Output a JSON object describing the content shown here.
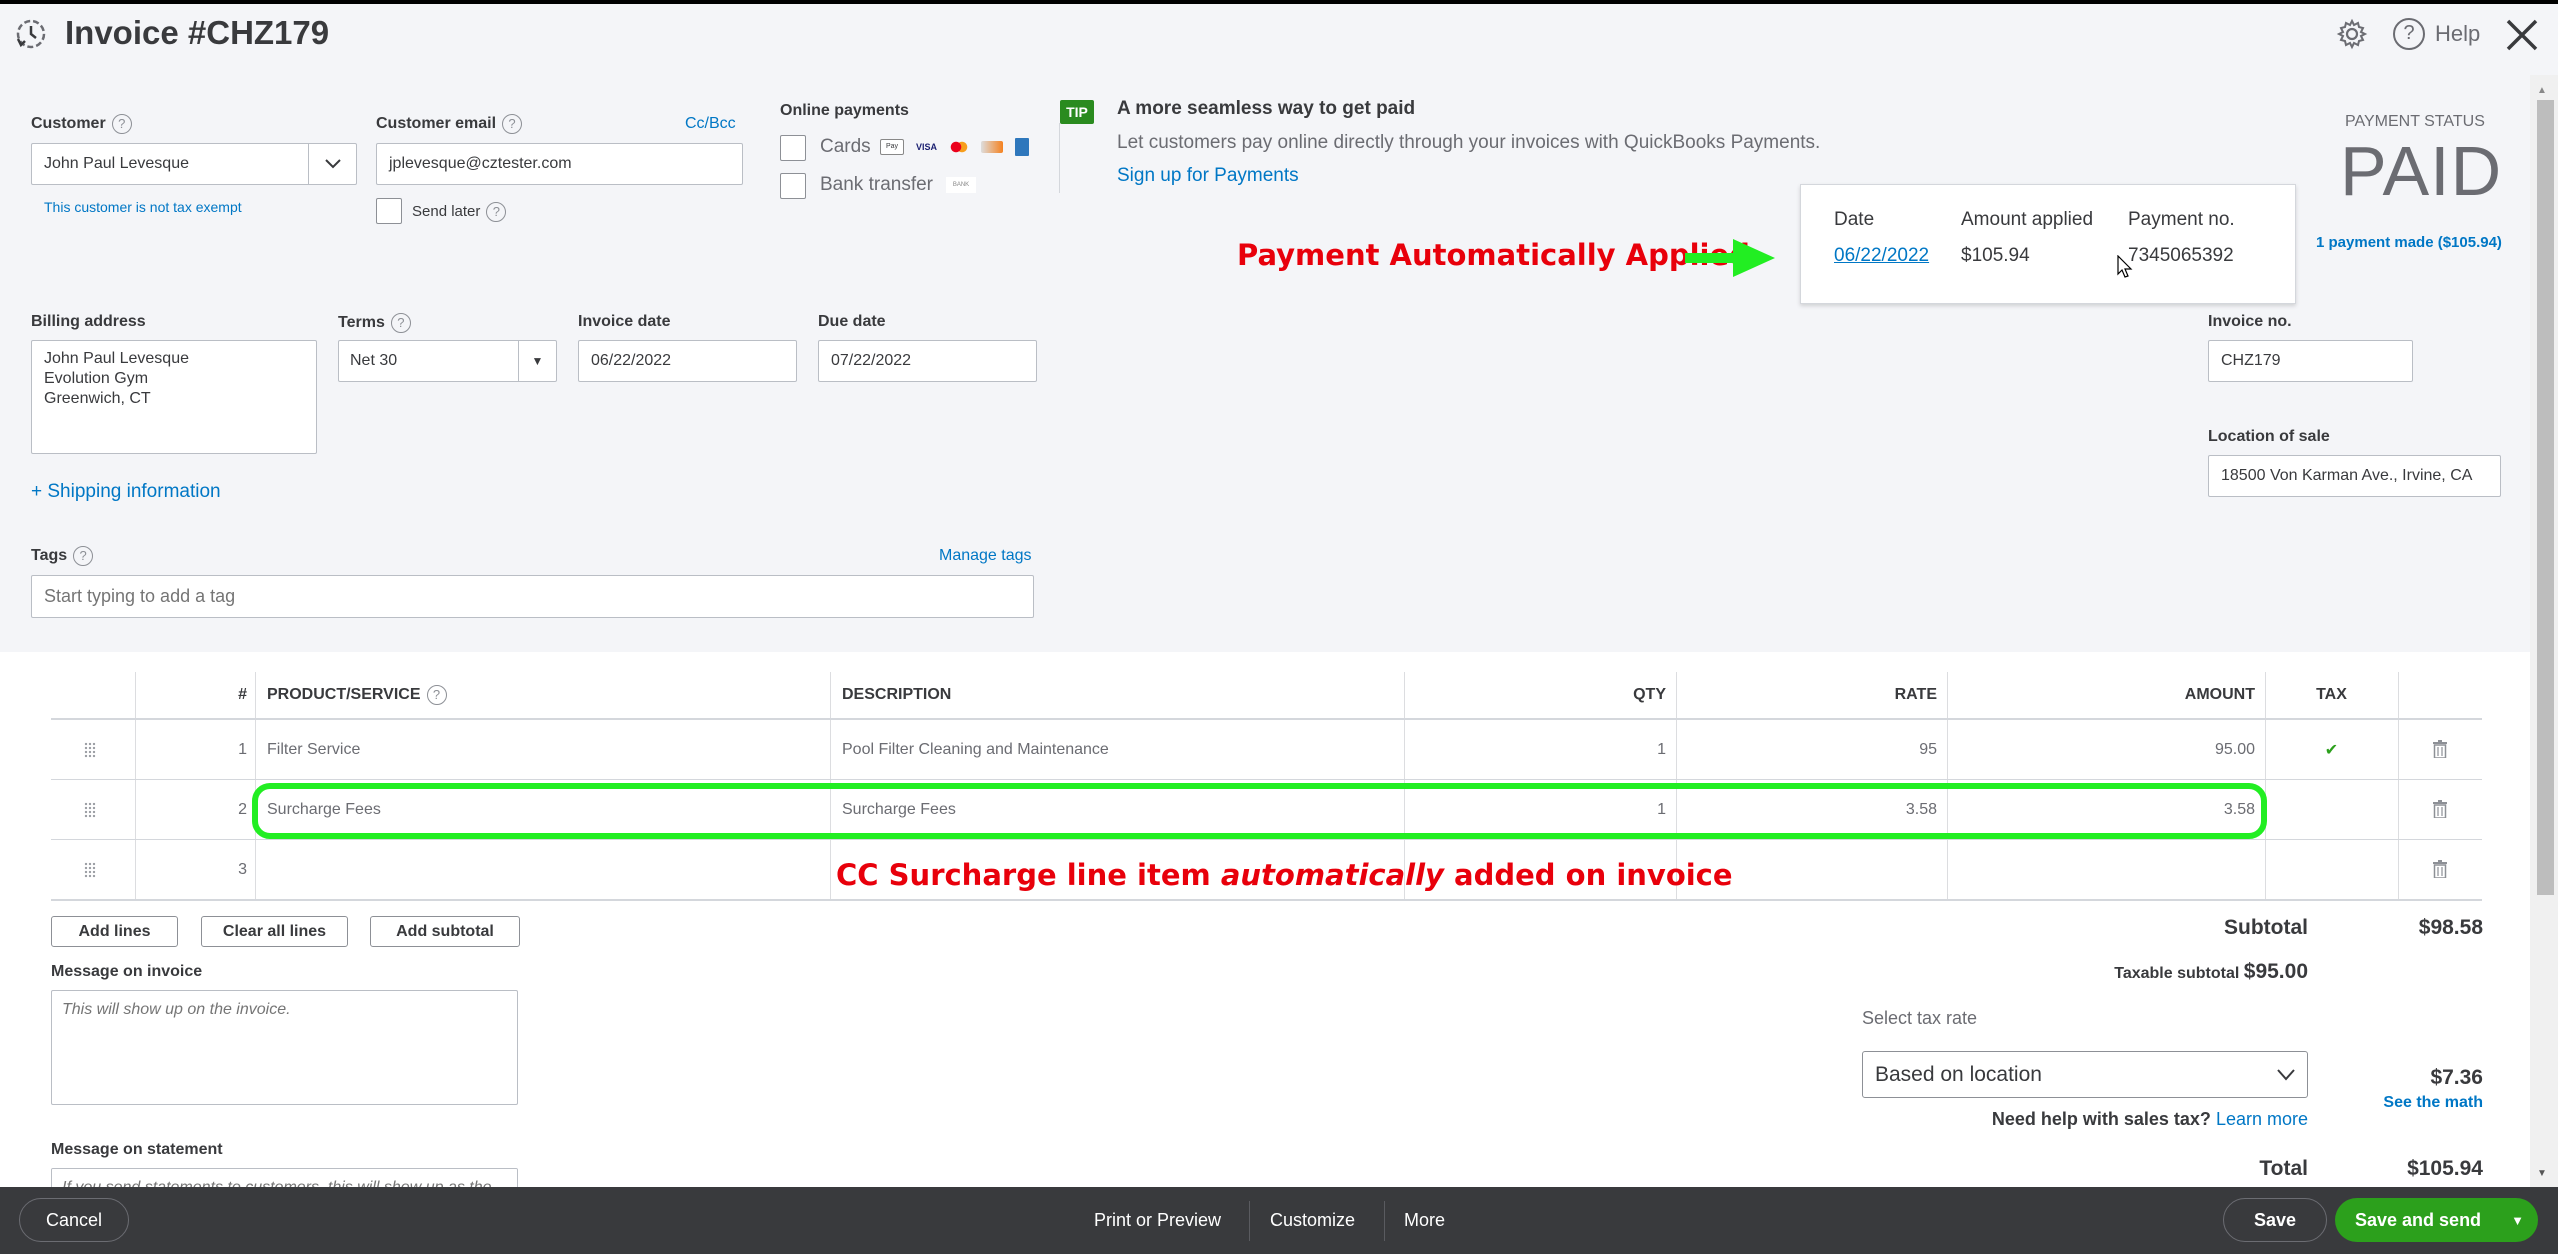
{
  "header": {
    "title": "Invoice #CHZ179",
    "icons": [
      "recent-transactions-icon",
      "gear-icon",
      "help-icon",
      "close-icon"
    ],
    "help_label": "Help"
  },
  "customer": {
    "label": "Customer",
    "value": "John Paul Levesque",
    "tax_note": "This customer is not tax exempt"
  },
  "email": {
    "label": "Customer email",
    "value": "jplevesque@cztester.com",
    "cc_bcc": "Cc/Bcc",
    "send_later": "Send later"
  },
  "online_payments": {
    "label": "Online payments",
    "cards": "Cards",
    "card_brands": [
      "Apple Pay",
      "VISA",
      "Mastercard",
      "Discover",
      "Amex"
    ],
    "bank": "Bank transfer",
    "bank_badge": "BANK"
  },
  "tip": {
    "badge": "TIP",
    "title": "A more seamless way to get paid",
    "body": "Let customers pay online directly through your invoices with QuickBooks Payments.",
    "link": "Sign up for Payments"
  },
  "payment_status": {
    "label": "PAYMENT STATUS",
    "value": "PAID",
    "payments_link": "1 payment made ($105.94)"
  },
  "payment_popup": {
    "headers": [
      "Date",
      "Amount applied",
      "Payment no."
    ],
    "row": {
      "date": "06/22/2022",
      "amount": "$105.94",
      "payment_no": "7345065392"
    }
  },
  "annotations": {
    "payment": "Payment Automatically Applied",
    "surcharge_pre": "CC Surcharge line item ",
    "surcharge_em": "automatically",
    "surcharge_post": " added on invoice",
    "arrow_color": "#22ee22",
    "text_color": "#e8000b"
  },
  "billing": {
    "label": "Billing address",
    "lines": [
      "John Paul Levesque",
      "Evolution Gym",
      "Greenwich, CT"
    ]
  },
  "terms": {
    "label": "Terms",
    "value": "Net 30"
  },
  "invoice_date": {
    "label": "Invoice date",
    "value": "06/22/2022"
  },
  "due_date": {
    "label": "Due date",
    "value": "07/22/2022"
  },
  "invoice_no": {
    "label": "Invoice no.",
    "value": "CHZ179"
  },
  "location": {
    "label": "Location of sale",
    "value": "18500 Von Karman Ave., Irvine, CA"
  },
  "shipping_link": "+ Shipping information",
  "tags": {
    "label": "Tags",
    "manage": "Manage tags",
    "placeholder": "Start typing to add a tag"
  },
  "table": {
    "headers": {
      "num": "#",
      "product": "PRODUCT/SERVICE",
      "description": "DESCRIPTION",
      "qty": "QTY",
      "rate": "RATE",
      "amount": "AMOUNT",
      "tax": "TAX"
    },
    "rows": [
      {
        "num": "1",
        "product": "Filter Service",
        "description": "Pool Filter Cleaning and Maintenance",
        "qty": "1",
        "rate": "95",
        "amount": "95.00",
        "tax": "✔"
      },
      {
        "num": "2",
        "product": "Surcharge Fees",
        "description": "Surcharge Fees",
        "qty": "1",
        "rate": "3.58",
        "amount": "3.58",
        "tax": ""
      },
      {
        "num": "3",
        "product": "",
        "description": "",
        "qty": "",
        "rate": "",
        "amount": "",
        "tax": ""
      }
    ]
  },
  "line_buttons": {
    "add": "Add lines",
    "clear": "Clear all lines",
    "subtotal": "Add subtotal"
  },
  "message_invoice": {
    "label": "Message on invoice",
    "placeholder": "This will show up on the invoice."
  },
  "message_statement": {
    "label": "Message on statement",
    "placeholder": "If you send statements to customers, this will show up as the description for this invoice."
  },
  "totals": {
    "subtotal_label": "Subtotal",
    "subtotal": "$98.58",
    "taxable_label": "Taxable subtotal",
    "taxable": "$95.00",
    "tax_rate_label": "Select tax rate",
    "tax_rate_value": "Based on location",
    "tax_amount": "$7.36",
    "see_math": "See the math",
    "help_text": "Need help with sales tax?",
    "learn_more": "Learn more",
    "total_label": "Total",
    "total": "$105.94"
  },
  "footer": {
    "cancel": "Cancel",
    "print": "Print or Preview",
    "customize": "Customize",
    "more": "More",
    "save": "Save",
    "save_send": "Save and send",
    "accent": "#2ca01c"
  }
}
